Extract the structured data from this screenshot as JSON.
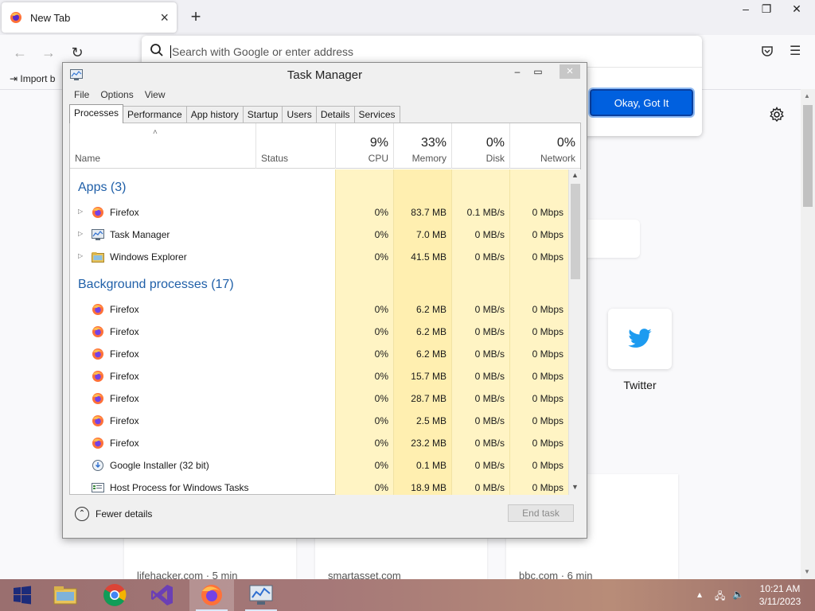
{
  "firefox": {
    "tab_title": "New Tab",
    "search_placeholder": "Search with Google or enter address",
    "import_label": "Import b",
    "ok_button": "Okay, Got It",
    "twitter_label": "Twitter",
    "stories": [
      "lifehacker.com · 5 min",
      "smartasset.com",
      "bbc.com · 6 min"
    ]
  },
  "task_manager": {
    "title": "Task Manager",
    "menu": [
      "File",
      "Options",
      "View"
    ],
    "tabs": [
      "Processes",
      "Performance",
      "App history",
      "Startup",
      "Users",
      "Details",
      "Services"
    ],
    "active_tab": "Processes",
    "columns": {
      "name": "Name",
      "status": "Status",
      "cpu": {
        "pct": "9%",
        "label": "CPU"
      },
      "memory": {
        "pct": "33%",
        "label": "Memory"
      },
      "disk": {
        "pct": "0%",
        "label": "Disk"
      },
      "network": {
        "pct": "0%",
        "label": "Network"
      }
    },
    "groups": {
      "apps": "Apps (3)",
      "background": "Background processes (17)"
    },
    "apps": [
      {
        "name": "Firefox",
        "icon": "firefox-icon",
        "cpu": "0%",
        "memory": "83.7 MB",
        "disk": "0.1 MB/s",
        "network": "0 Mbps"
      },
      {
        "name": "Task Manager",
        "icon": "task-manager-icon",
        "cpu": "0%",
        "memory": "7.0 MB",
        "disk": "0 MB/s",
        "network": "0 Mbps"
      },
      {
        "name": "Windows Explorer",
        "icon": "folder-icon",
        "cpu": "0%",
        "memory": "41.5 MB",
        "disk": "0 MB/s",
        "network": "0 Mbps"
      }
    ],
    "background": [
      {
        "name": "Firefox",
        "icon": "firefox-icon",
        "cpu": "0%",
        "memory": "6.2 MB",
        "disk": "0 MB/s",
        "network": "0 Mbps"
      },
      {
        "name": "Firefox",
        "icon": "firefox-icon",
        "cpu": "0%",
        "memory": "6.2 MB",
        "disk": "0 MB/s",
        "network": "0 Mbps"
      },
      {
        "name": "Firefox",
        "icon": "firefox-icon",
        "cpu": "0%",
        "memory": "6.2 MB",
        "disk": "0 MB/s",
        "network": "0 Mbps"
      },
      {
        "name": "Firefox",
        "icon": "firefox-icon",
        "cpu": "0%",
        "memory": "15.7 MB",
        "disk": "0 MB/s",
        "network": "0 Mbps"
      },
      {
        "name": "Firefox",
        "icon": "firefox-icon",
        "cpu": "0%",
        "memory": "28.7 MB",
        "disk": "0 MB/s",
        "network": "0 Mbps"
      },
      {
        "name": "Firefox",
        "icon": "firefox-icon",
        "cpu": "0%",
        "memory": "2.5 MB",
        "disk": "0 MB/s",
        "network": "0 Mbps"
      },
      {
        "name": "Firefox",
        "icon": "firefox-icon",
        "cpu": "0%",
        "memory": "23.2 MB",
        "disk": "0 MB/s",
        "network": "0 Mbps"
      },
      {
        "name": "Google Installer (32 bit)",
        "icon": "installer-icon",
        "cpu": "0%",
        "memory": "0.1 MB",
        "disk": "0 MB/s",
        "network": "0 Mbps"
      },
      {
        "name": "Host Process for Windows Tasks",
        "icon": "host-process-icon",
        "cpu": "0%",
        "memory": "18.9 MB",
        "disk": "0 MB/s",
        "network": "0 Mbps"
      }
    ],
    "fewer_details": "Fewer details",
    "end_task": "End task"
  },
  "taskbar": {
    "apps": [
      "windows-start-icon",
      "file-explorer-icon",
      "chrome-icon",
      "visual-studio-icon",
      "firefox-icon",
      "task-manager-icon"
    ],
    "time": "10:21 AM",
    "date": "3/11/2023"
  },
  "colors": {
    "accent_blue": "#0060df",
    "group_blue": "#1f5fa8",
    "heat_light": "#fff4c4",
    "heat_mid": "#ffefb0"
  }
}
